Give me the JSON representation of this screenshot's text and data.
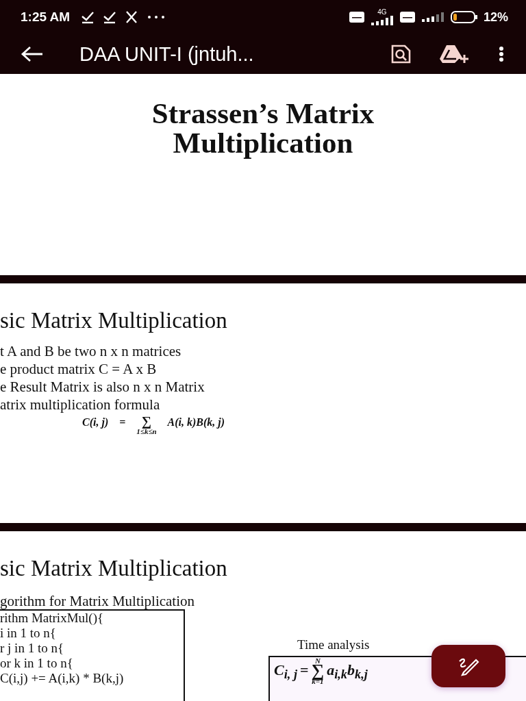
{
  "status_bar": {
    "time": "1:25 AM",
    "network": "4G",
    "battery": "12%"
  },
  "app_bar": {
    "title": "DAA UNIT-I (jntuh..."
  },
  "pages": [
    {
      "kind": "title",
      "title_lines": [
        "Strassen’s Matrix",
        "Multiplication"
      ]
    },
    {
      "kind": "bullets",
      "heading": "sic Matrix Multiplication",
      "lines": [
        "t A and B be two n x n matrices",
        "e product matrix C = A x B",
        "e Result Matrix is also n x n Matrix",
        "atrix multiplication formula"
      ],
      "formula": {
        "lhs": "C(i, j)",
        "eq": "=",
        "sum": "∑",
        "sum_lower": "1≤k≤n",
        "rhs": "A(i, k)B(k, j)"
      }
    },
    {
      "kind": "algorithm",
      "heading": "sic Matrix Multiplication",
      "subheading": "gorithm for Matrix Multiplication",
      "code_lines": [
        "rithm MatrixMul(){",
        "i in 1 to n{",
        "r j in 1 to n{",
        "or k in 1 to n{",
        "C(i,j) += A(i,k) * B(k,j)"
      ],
      "side_title": "Time analysis",
      "side_formula": {
        "lhs": "C$_{i, j}$",
        "eq": "=",
        "sum": "∑",
        "sum_upper": "N",
        "sum_lower": "k=1",
        "rhs": "a$_{i,k}$b$_{k,j}$"
      }
    }
  ]
}
